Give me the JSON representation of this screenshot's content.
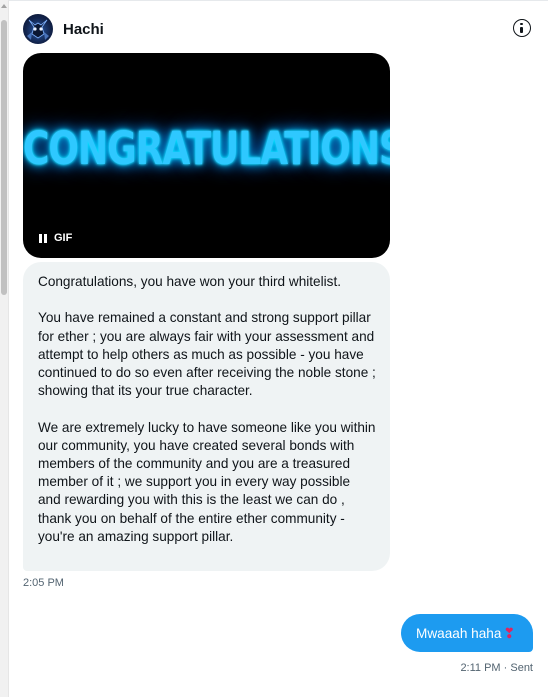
{
  "conversation": {
    "user_name": "Hachi",
    "info_icon": "info-circle-icon",
    "avatar_icon": "hachi-avatar"
  },
  "gif": {
    "text": "CONGRATULATIONS",
    "label": "GIF",
    "control_icon": "pause-icon",
    "text_color": "#2ec8ff"
  },
  "messages": {
    "incoming": {
      "paragraphs": [
        "Congratulations, you have won your third whitelist.",
        "You have remained a constant and strong support pillar for ether ; you are always fair with your assessment and attempt to help others as much as possible - you have continued to do so even after receiving the noble stone ; showing that its your true character.",
        "We are extremely lucky to have someone like you within our community, you have created several bonds with members of the community and you are a treasured member of it ; we support you in every way possible and rewarding you with this is the least we can do , thank you on behalf of the entire ether community - you're an amazing support pillar."
      ],
      "timestamp": "2:05 PM",
      "bubble_color": "#eff3f4"
    },
    "outgoing": {
      "text": "Mwaaah haha",
      "emoji": "❣",
      "timestamp": "2:11 PM · Sent",
      "bubble_color": "#1d9bf0"
    }
  }
}
